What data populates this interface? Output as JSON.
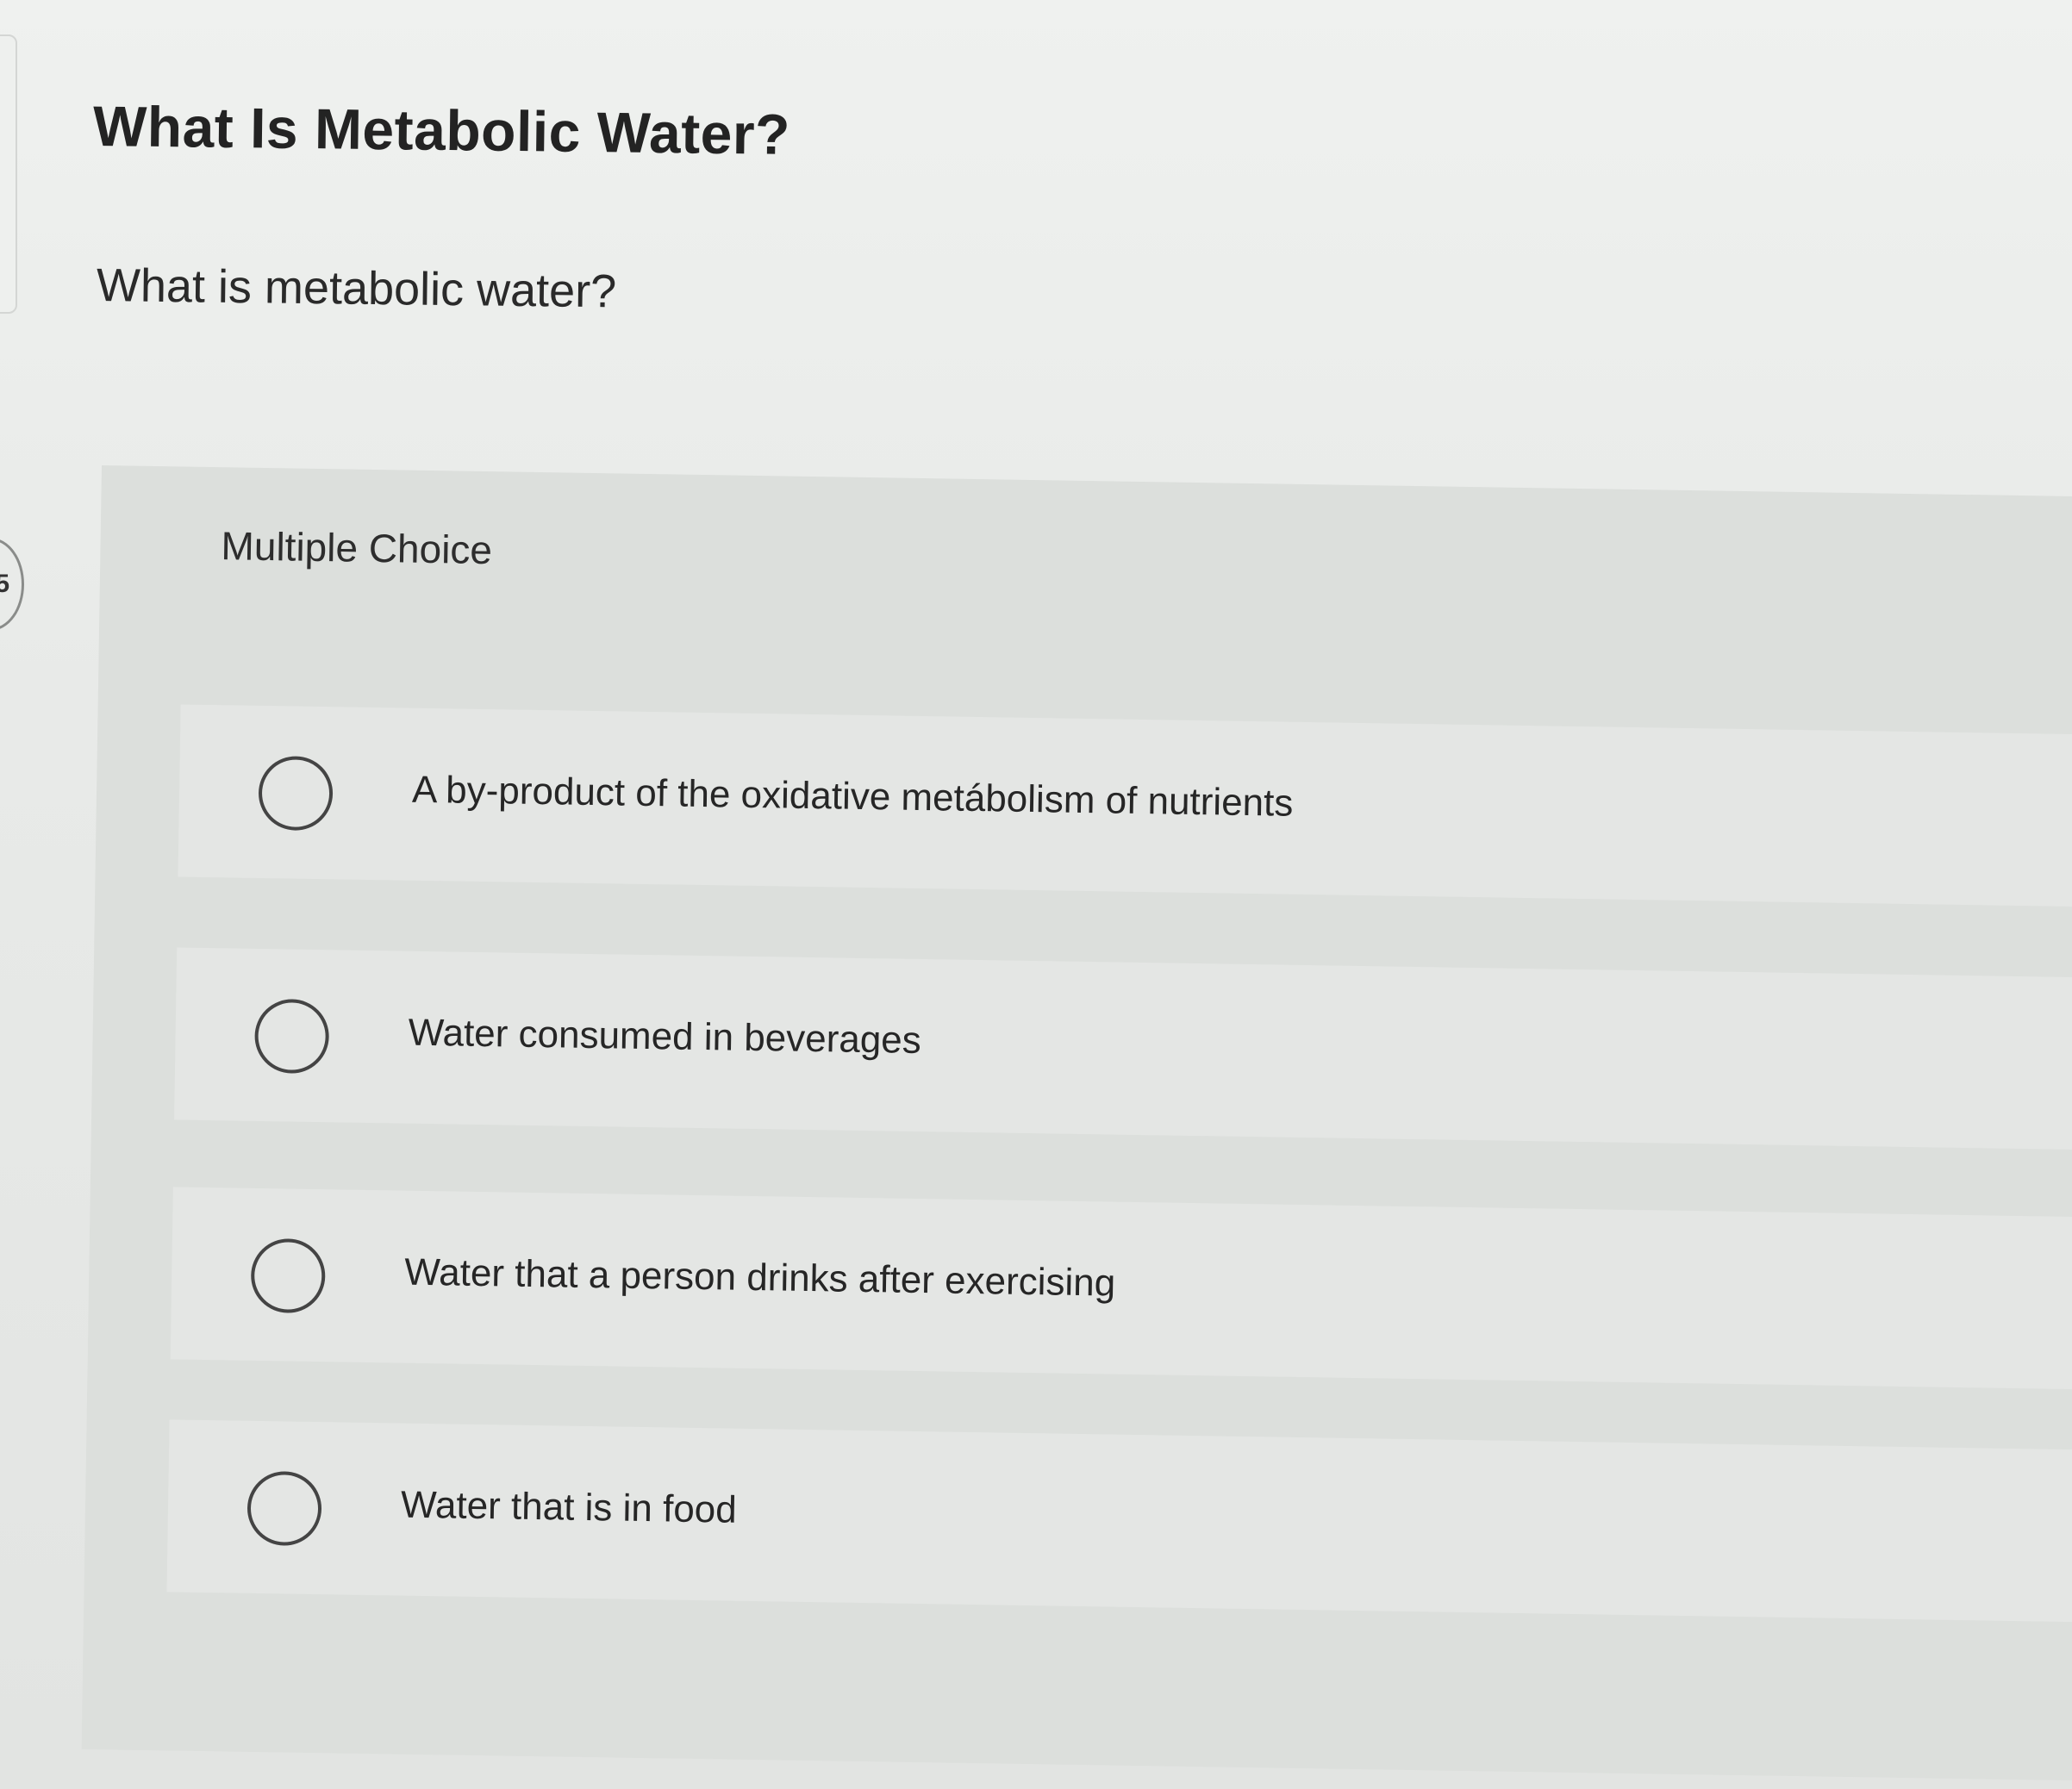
{
  "question_number": "5",
  "title": "What Is Metabolic Water?",
  "prompt": "What is metabolic water?",
  "question_type": "Multiple Choice",
  "options": [
    {
      "label": "A by-product of the oxidative metábolism of nutrients"
    },
    {
      "label": "Water consumed in beverages"
    },
    {
      "label": "Water that a person drinks after exercising"
    },
    {
      "label": "Water that is in food"
    }
  ]
}
